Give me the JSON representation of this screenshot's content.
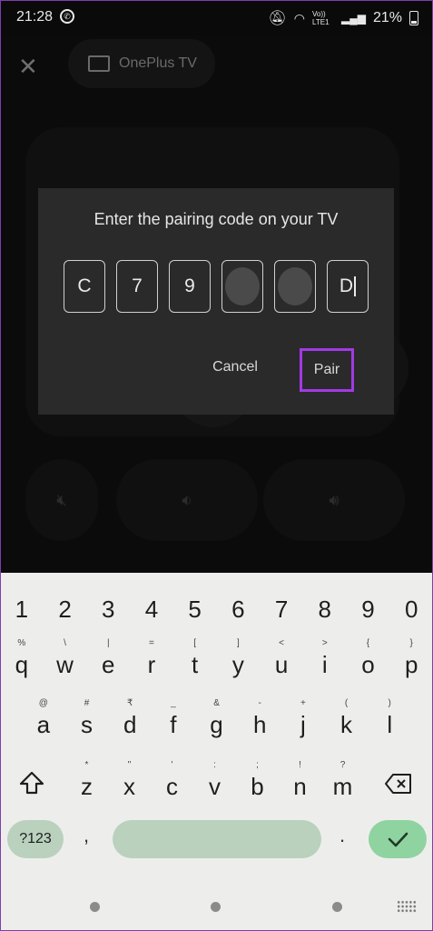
{
  "status_bar": {
    "time": "21:28",
    "battery": "21%",
    "volte_label": "Vo)) LTE1"
  },
  "remote": {
    "device_name": "OnePlus TV"
  },
  "dialog": {
    "title": "Enter the pairing code on your TV",
    "code": [
      {
        "char": "C",
        "masked": false
      },
      {
        "char": "7",
        "masked": false
      },
      {
        "char": "9",
        "masked": false
      },
      {
        "char": "",
        "masked": true
      },
      {
        "char": "",
        "masked": true
      },
      {
        "char": "D",
        "masked": false,
        "cursor": true
      }
    ],
    "cancel_label": "Cancel",
    "pair_label": "Pair",
    "highlight_color": "#a23ae6"
  },
  "keyboard": {
    "numbers": [
      "1",
      "2",
      "3",
      "4",
      "5",
      "6",
      "7",
      "8",
      "9",
      "0"
    ],
    "row_q": [
      {
        "k": "q",
        "h": "%"
      },
      {
        "k": "w",
        "h": "\\"
      },
      {
        "k": "e",
        "h": "|"
      },
      {
        "k": "r",
        "h": "="
      },
      {
        "k": "t",
        "h": "["
      },
      {
        "k": "y",
        "h": "]"
      },
      {
        "k": "u",
        "h": "<"
      },
      {
        "k": "i",
        "h": ">"
      },
      {
        "k": "o",
        "h": "{"
      },
      {
        "k": "p",
        "h": "}"
      }
    ],
    "row_a": [
      {
        "k": "a",
        "h": "@"
      },
      {
        "k": "s",
        "h": "#"
      },
      {
        "k": "d",
        "h": "₹"
      },
      {
        "k": "f",
        "h": "_"
      },
      {
        "k": "g",
        "h": "&"
      },
      {
        "k": "h",
        "h": "-"
      },
      {
        "k": "j",
        "h": "+"
      },
      {
        "k": "k",
        "h": "("
      },
      {
        "k": "l",
        "h": ")"
      }
    ],
    "row_z": [
      {
        "k": "z",
        "h": "*"
      },
      {
        "k": "x",
        "h": "\""
      },
      {
        "k": "c",
        "h": "'"
      },
      {
        "k": "v",
        "h": ":"
      },
      {
        "k": "b",
        "h": ";"
      },
      {
        "k": "n",
        "h": "!"
      },
      {
        "k": "m",
        "h": "?"
      }
    ],
    "symbols_label": "?123",
    "comma": ",",
    "period": ".",
    "enter_color": "#8fd3a1",
    "accent_color": "#b9d1bd"
  },
  "icons": {
    "close": "close-icon",
    "tv": "tv-icon",
    "shift": "shift-icon",
    "backspace": "backspace-icon",
    "enter": "checkmark-icon",
    "grid": "keyboard-grid-icon"
  }
}
